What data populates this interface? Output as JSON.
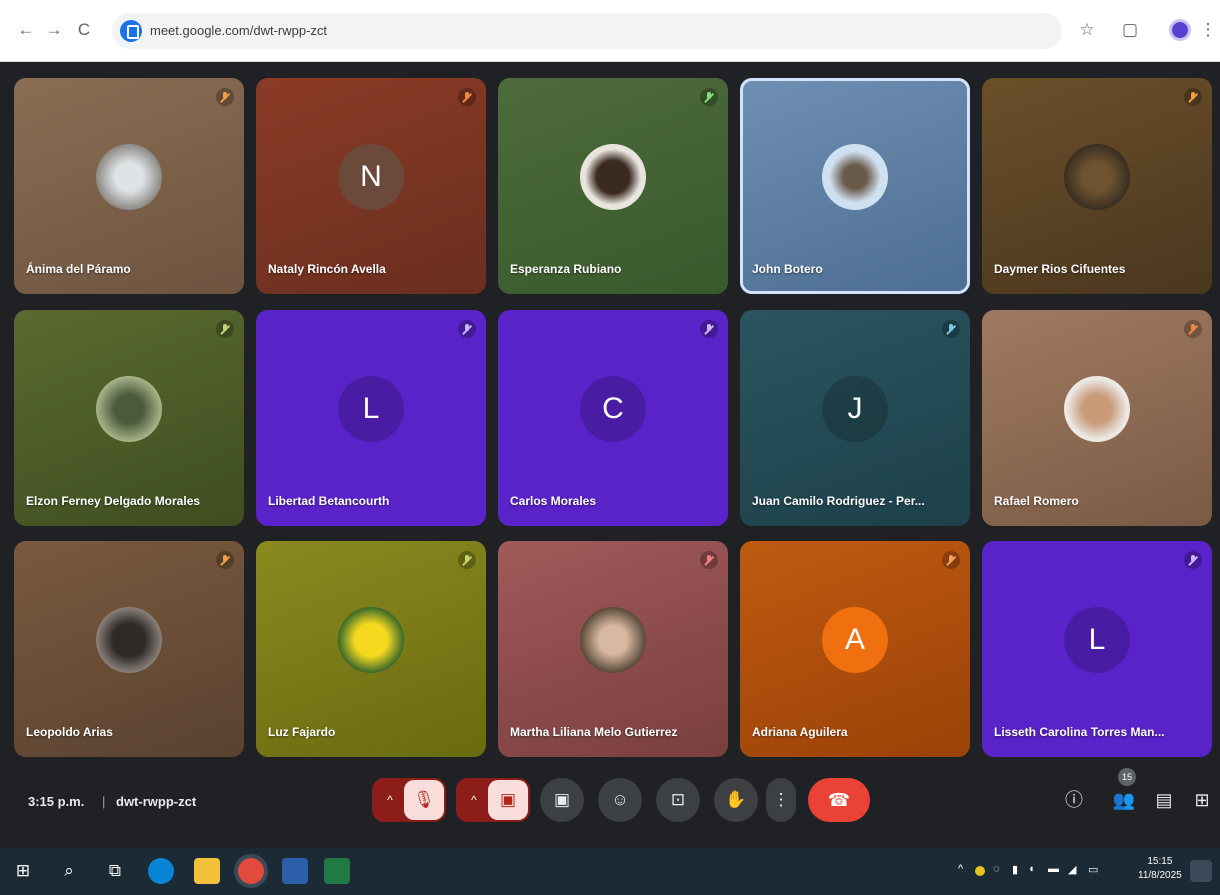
{
  "browser": {
    "url": "meet.google.com/dwt-rwpp-zct",
    "back_icon": "←",
    "forward_icon": "→",
    "reload_icon": "C",
    "star_icon": "☆",
    "extensions_icon": "▢",
    "menu_icon": "⋮"
  },
  "participants": [
    {
      "name": "Ánima del Páramo",
      "letter": "",
      "bg": "linear-gradient(160deg,#8a6d52,#6e5440)",
      "avatar": "radial-gradient(circle,#dfe3e6 30%,#8d8a86 70%)",
      "mic_color": "#f0a040",
      "speaking": false
    },
    {
      "name": "Nataly Rincón Avella",
      "letter": "N",
      "bg": "linear-gradient(160deg,#8b3b26,#6a2e1f)",
      "avatar": "",
      "mic_color": "#f08a40",
      "speaking": false
    },
    {
      "name": "Esperanza Rubiano",
      "letter": "",
      "bg": "linear-gradient(160deg,#4e6b3c,#385a2b)",
      "avatar": "radial-gradient(circle,#3a2a20 35%,#e8e4de 60%)",
      "mic_color": "#7ee07e",
      "speaking": false
    },
    {
      "name": "John Botero",
      "letter": "",
      "bg": "linear-gradient(160deg,#6f8fb3,#4c6e92)",
      "avatar": "radial-gradient(circle,#6a5a4a 25%,#cfe0f0 55%)",
      "mic_color": "",
      "speaking": true
    },
    {
      "name": "Daymer Rios Cifuentes",
      "letter": "",
      "bg": "linear-gradient(160deg,#6b4f2a,#4a371e)",
      "avatar": "radial-gradient(circle,#6e5330 30%,#3a2e22 70%)",
      "mic_color": "#f0a040",
      "speaking": false
    },
    {
      "name": "Elzon Ferney Delgado Morales",
      "letter": "",
      "bg": "linear-gradient(160deg,#5a6a30,#3f4d20)",
      "avatar": "radial-gradient(circle,#4a5a3a 30%,#a8b48a 70%)",
      "mic_color": "#c8d070",
      "speaking": false
    },
    {
      "name": "Libertad Betancourth",
      "letter": "L",
      "bg": "#5a23c9",
      "avatar": "",
      "mic_color": "#cdb8ff",
      "speaking": false
    },
    {
      "name": "Carlos Morales",
      "letter": "C",
      "bg": "#5a23c9",
      "avatar": "",
      "mic_color": "#cdb8ff",
      "speaking": false
    },
    {
      "name": "Juan Camilo Rodriguez - Per...",
      "letter": "J",
      "bg": "linear-gradient(160deg,#2a5560,#1d404a)",
      "avatar": "",
      "mic_color": "#7ec8e0",
      "speaking": false
    },
    {
      "name": "Rafael Romero",
      "letter": "",
      "bg": "linear-gradient(160deg,#a07a60,#7a5a44)",
      "avatar": "radial-gradient(circle,#c89a78 30%,#ece8e4 65%)",
      "mic_color": "#f08a40",
      "speaking": false
    },
    {
      "name": "Leopoldo Arias",
      "letter": "",
      "bg": "linear-gradient(160deg,#7a5a3e,#5a4230)",
      "avatar": "radial-gradient(circle,#2e2a28 35%,#8a8078 70%)",
      "mic_color": "#f0a040",
      "speaking": false
    },
    {
      "name": "Luz Fajardo",
      "letter": "",
      "bg": "linear-gradient(160deg,#8a8a20,#6a6a10)",
      "avatar": "radial-gradient(circle,#f5d820 35%,#3a6a2a 70%)",
      "mic_color": "#c8d070",
      "speaking": false
    },
    {
      "name": "Martha Liliana Melo Gutierrez",
      "letter": "",
      "bg": "linear-gradient(160deg,#a05a5a,#7a3e3e)",
      "avatar": "radial-gradient(circle,#d8b8a0 30%,#5a4a3a 70%)",
      "mic_color": "#f08080",
      "speaking": false
    },
    {
      "name": "Adriana Aguilera",
      "letter": "A",
      "bg": "linear-gradient(160deg,#c05a10,#9a4208)",
      "avatar": "",
      "mic_color": "#f0a060",
      "speaking": false
    },
    {
      "name": "Lisseth Carolina Torres Man...",
      "letter": "L",
      "bg": "#5a23c9",
      "avatar": "",
      "mic_color": "#cdb8ff",
      "speaking": false
    }
  ],
  "letter_bg": {
    "Nataly Rincón Avella": "#6b4a3c",
    "Adriana Aguilera": "#f07010"
  },
  "controls": {
    "time": "3:15 p.m.",
    "separator": "|",
    "meeting_code": "dwt-rwpp-zct",
    "mic_icon": "🎙",
    "camera_icon": "▣",
    "chevron_icon": "^",
    "captions_icon": "▣",
    "emoji_icon": "☺",
    "present_icon": "⊡",
    "raise_hand_icon": "✋",
    "more_icon": "⋮",
    "leave_icon": "☎",
    "info_icon": "ⓘ",
    "people_icon": "👥",
    "people_count": "15",
    "chat_icon": "▤",
    "activities_icon": "⊞"
  },
  "taskbar": {
    "start_icon": "⊞",
    "search_icon": "⌕",
    "taskview_icon": "⧉",
    "clock_time": "15:15",
    "clock_date": "11/8/2025"
  }
}
